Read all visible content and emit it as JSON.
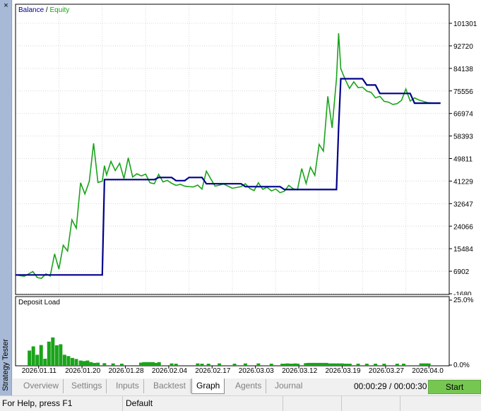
{
  "window": {
    "vertical_title": "Strategy Tester",
    "close_glyph": "×"
  },
  "tabs": [
    {
      "label": "Overview",
      "active": false
    },
    {
      "label": "Settings",
      "active": false
    },
    {
      "label": "Inputs",
      "active": false
    },
    {
      "label": "Backtest",
      "active": false
    },
    {
      "label": "Graph",
      "active": true
    },
    {
      "label": "Agents",
      "active": false
    },
    {
      "label": "Journal",
      "active": false
    }
  ],
  "controls": {
    "timer": "00:00:29 / 00:00:30",
    "start_label": "Start",
    "start_color": "#76c752"
  },
  "status_bar": {
    "help": "For Help, press F1",
    "profile": "Default"
  },
  "chart_data": [
    {
      "type": "line",
      "legend": [
        "Balance",
        "Equity"
      ],
      "legend_separator": "/",
      "legend_placement": "top-left",
      "y_ticks": [
        "101301",
        "92720",
        "84138",
        "75556",
        "66974",
        "58393",
        "49811",
        "41229",
        "32647",
        "24066",
        "15484",
        "6902",
        "-1680"
      ],
      "ylim": [
        -1680,
        101301
      ],
      "grid": true,
      "series": [
        {
          "name": "Balance",
          "color": "#00008b",
          "x": [
            0,
            0.2,
            0.205,
            0.32,
            0.33,
            0.36,
            0.37,
            0.39,
            0.4,
            0.43,
            0.44,
            0.52,
            0.53,
            0.61,
            0.62,
            0.74,
            0.745,
            0.75,
            0.8,
            0.81,
            0.83,
            0.84,
            0.91,
            0.92,
            0.98
          ],
          "values": [
            5500,
            5500,
            41800,
            41800,
            42600,
            42600,
            41400,
            41400,
            42600,
            42600,
            40200,
            40200,
            39100,
            39100,
            38000,
            38000,
            61500,
            80200,
            80200,
            77800,
            77800,
            74600,
            74600,
            70900,
            70900
          ]
        },
        {
          "name": "Equity",
          "color": "#1aa31a",
          "x": [
            0,
            0.02,
            0.04,
            0.05,
            0.06,
            0.07,
            0.08,
            0.09,
            0.1,
            0.11,
            0.12,
            0.13,
            0.14,
            0.15,
            0.16,
            0.17,
            0.18,
            0.19,
            0.2,
            0.205,
            0.21,
            0.22,
            0.23,
            0.24,
            0.25,
            0.26,
            0.27,
            0.28,
            0.29,
            0.3,
            0.31,
            0.32,
            0.33,
            0.34,
            0.35,
            0.36,
            0.37,
            0.38,
            0.39,
            0.4,
            0.41,
            0.42,
            0.43,
            0.44,
            0.46,
            0.48,
            0.5,
            0.52,
            0.53,
            0.54,
            0.55,
            0.56,
            0.57,
            0.58,
            0.59,
            0.6,
            0.61,
            0.62,
            0.63,
            0.64,
            0.65,
            0.66,
            0.67,
            0.68,
            0.69,
            0.7,
            0.71,
            0.72,
            0.73,
            0.74,
            0.745,
            0.75,
            0.76,
            0.77,
            0.78,
            0.79,
            0.8,
            0.81,
            0.82,
            0.83,
            0.84,
            0.85,
            0.86,
            0.87,
            0.88,
            0.89,
            0.9,
            0.91,
            0.92,
            0.93,
            0.94,
            0.95,
            0.96,
            0.97,
            0.98
          ],
          "values": [
            5500,
            5000,
            6800,
            4500,
            4200,
            5900,
            5100,
            13500,
            7700,
            16800,
            14600,
            26500,
            23300,
            40600,
            36300,
            41100,
            55600,
            40700,
            41200,
            47100,
            43600,
            48700,
            45200,
            48000,
            42200,
            50100,
            42800,
            44000,
            43200,
            43900,
            40600,
            40200,
            43800,
            40900,
            41500,
            40400,
            39600,
            40000,
            39300,
            39100,
            39000,
            39700,
            38200,
            45000,
            39300,
            40100,
            38500,
            39100,
            40200,
            38400,
            37600,
            40600,
            38100,
            38900,
            37500,
            38200,
            36800,
            37400,
            39600,
            38300,
            37900,
            46000,
            40300,
            46500,
            43400,
            55200,
            52600,
            73500,
            61500,
            80200,
            97500,
            84000,
            80000,
            76500,
            79000,
            76800,
            77000,
            75500,
            75000,
            72900,
            73500,
            71600,
            71300,
            70400,
            70700,
            72000,
            76300,
            71700,
            72900,
            72100,
            71600,
            71100,
            71000,
            71000,
            71000
          ]
        }
      ]
    },
    {
      "type": "bar",
      "title": "Deposit Load",
      "y_ticks": [
        "25.0%",
        "0.0%"
      ],
      "ylim": [
        0,
        25
      ],
      "color": "#1aa31a",
      "x_ticks": [
        "2026.01.11",
        "2026.01.20",
        "2026.01.28",
        "2026.02.04",
        "2026.02.17",
        "2026.03.03",
        "2026.03.12",
        "2026.03.19",
        "2026.03.27",
        "2026.04.0"
      ],
      "x": [
        0.032,
        0.041,
        0.05,
        0.059,
        0.068,
        0.077,
        0.086,
        0.095,
        0.104,
        0.113,
        0.122,
        0.131,
        0.14,
        0.15,
        0.158,
        0.166,
        0.174,
        0.182,
        0.19,
        0.205,
        0.225,
        0.245,
        0.289,
        0.296,
        0.303,
        0.31,
        0.317,
        0.324,
        0.331,
        0.36,
        0.37,
        0.42,
        0.43,
        0.445,
        0.47,
        0.505,
        0.53,
        0.56,
        0.59,
        0.615,
        0.621,
        0.627,
        0.633,
        0.639,
        0.645,
        0.651,
        0.669,
        0.675,
        0.681,
        0.687,
        0.693,
        0.699,
        0.705,
        0.711,
        0.717,
        0.723,
        0.729,
        0.735,
        0.741,
        0.747,
        0.753,
        0.759,
        0.765,
        0.771,
        0.79,
        0.81,
        0.83,
        0.85,
        0.88,
        0.895,
        0.935,
        0.941,
        0.947,
        0.953
      ],
      "values": [
        5.8,
        7.4,
        4.2,
        7.9,
        2.7,
        9.2,
        10.8,
        7.8,
        8.2,
        4.2,
        3.7,
        3.0,
        2.6,
        2.0,
        1.8,
        2.0,
        1.4,
        1.1,
        1.2,
        1.0,
        0.9,
        0.8,
        1.2,
        1.4,
        1.4,
        1.4,
        1.4,
        1.1,
        1.4,
        0.9,
        0.8,
        0.9,
        0.8,
        0.8,
        0.9,
        0.8,
        0.9,
        0.9,
        0.8,
        0.8,
        0.8,
        0.9,
        0.8,
        0.8,
        0.9,
        0.8,
        1.0,
        1.1,
        1.1,
        1.1,
        1.1,
        1.1,
        1.1,
        1.1,
        1.1,
        0.9,
        0.9,
        0.9,
        0.9,
        0.9,
        0.9,
        0.8,
        0.8,
        0.8,
        0.8,
        0.8,
        0.8,
        0.8,
        0.8,
        0.8,
        0.9,
        0.9,
        0.9,
        0.9
      ]
    }
  ]
}
